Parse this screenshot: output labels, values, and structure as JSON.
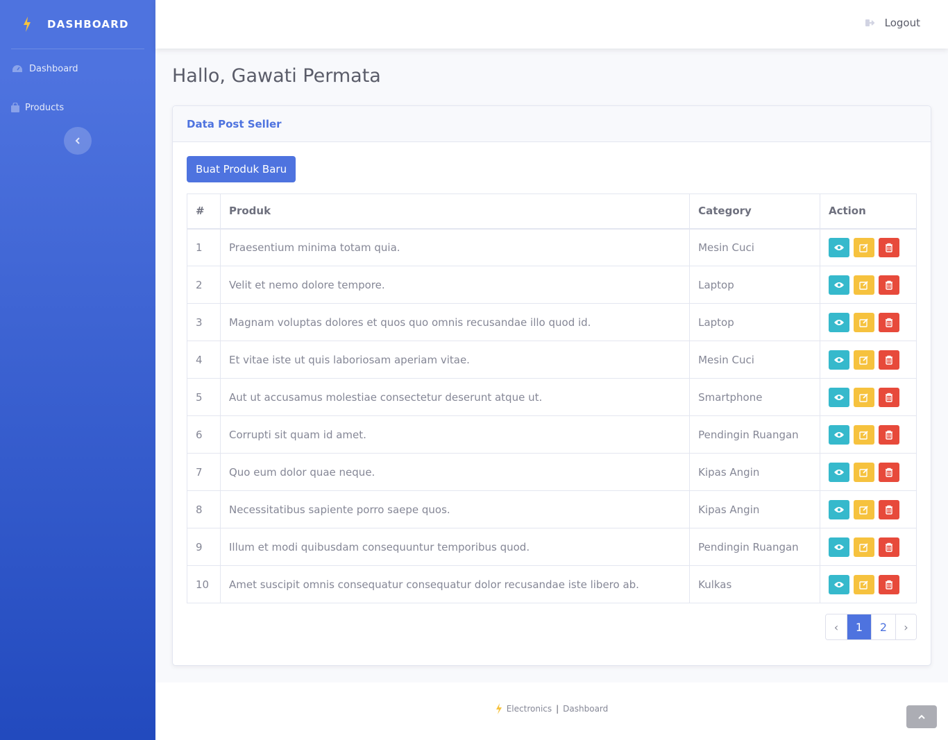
{
  "sidebar": {
    "brand": "DASHBOARD",
    "items": [
      {
        "label": "Dashboard",
        "icon": "tachometer-icon"
      },
      {
        "label": "Products",
        "icon": "shopping-bag-icon"
      }
    ]
  },
  "topbar": {
    "logout_label": "Logout"
  },
  "main": {
    "greeting": "Hallo, Gawati Permata",
    "card_title": "Data Post Seller",
    "new_button": "Buat Produk Baru",
    "table": {
      "headers": [
        "#",
        "Produk",
        "Category",
        "Action"
      ],
      "rows": [
        {
          "no": "1",
          "produk": "Praesentium minima totam quia.",
          "category": "Mesin Cuci"
        },
        {
          "no": "2",
          "produk": "Velit et nemo dolore tempore.",
          "category": "Laptop"
        },
        {
          "no": "3",
          "produk": "Magnam voluptas dolores et quos quo omnis recusandae illo quod id.",
          "category": "Laptop"
        },
        {
          "no": "4",
          "produk": "Et vitae iste ut quis laboriosam aperiam vitae.",
          "category": "Mesin Cuci"
        },
        {
          "no": "5",
          "produk": "Aut ut accusamus molestiae consectetur deserunt atque ut.",
          "category": "Smartphone"
        },
        {
          "no": "6",
          "produk": "Corrupti sit quam id amet.",
          "category": "Pendingin Ruangan"
        },
        {
          "no": "7",
          "produk": "Quo eum dolor quae neque.",
          "category": "Kipas Angin"
        },
        {
          "no": "8",
          "produk": "Necessitatibus sapiente porro saepe quos.",
          "category": "Kipas Angin"
        },
        {
          "no": "9",
          "produk": "Illum et modi quibusdam consequuntur temporibus quod.",
          "category": "Pendingin Ruangan"
        },
        {
          "no": "10",
          "produk": "Amet suscipit omnis consequatur consequatur dolor recusandae iste libero ab.",
          "category": "Kulkas"
        }
      ]
    },
    "pagination": {
      "prev": "‹",
      "pages": [
        "1",
        "2"
      ],
      "active": "1",
      "next": "›"
    }
  },
  "footer": {
    "left": "Electronics",
    "separator": "|",
    "right": "Dashboard"
  },
  "colors": {
    "primary": "#4e73df",
    "info": "#36b9cc",
    "warning": "#f6c23e",
    "danger": "#e74a3b",
    "bolt": "#f6c23e"
  }
}
